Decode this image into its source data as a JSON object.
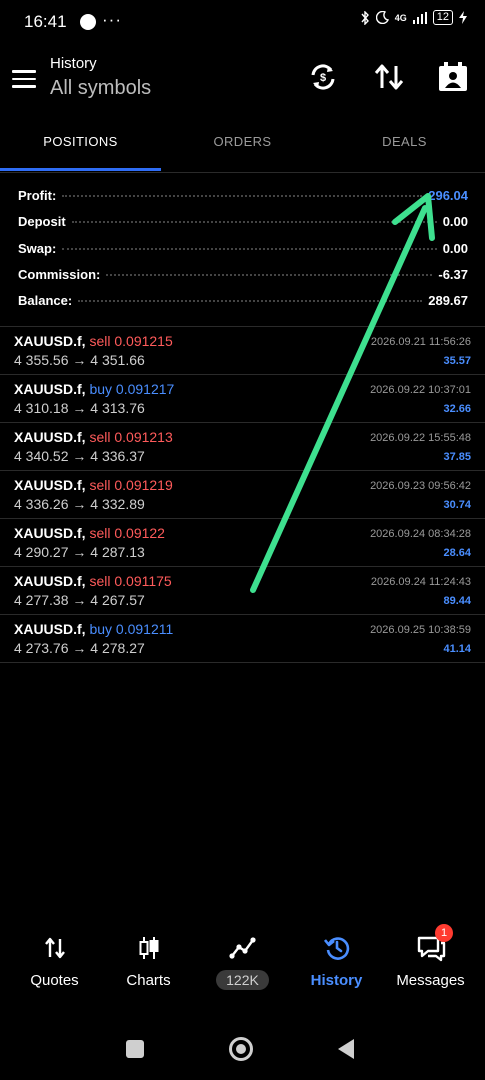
{
  "status_bar": {
    "time": "16:41",
    "dots": "···",
    "network": "4G",
    "battery": "12"
  },
  "header": {
    "title": "History",
    "subtitle": "All symbols"
  },
  "tabs": [
    {
      "label": "POSITIONS",
      "active": true
    },
    {
      "label": "ORDERS",
      "active": false
    },
    {
      "label": "DEALS",
      "active": false
    }
  ],
  "summary": [
    {
      "label": "Profit:",
      "value": "296.04",
      "highlight": true
    },
    {
      "label": "Deposit",
      "value": "0.00",
      "highlight": false
    },
    {
      "label": "Swap:",
      "value": "0.00",
      "highlight": false
    },
    {
      "label": "Commission:",
      "value": "-6.37",
      "highlight": false
    },
    {
      "label": "Balance:",
      "value": "289.67",
      "highlight": false
    }
  ],
  "deals": [
    {
      "symbol": "XAUUSD.f,",
      "side": "sell",
      "volume": "0.091215",
      "open": "4 355.56",
      "arrow": "→",
      "close": "4 351.66",
      "time": "2026.09.21 11:56:26",
      "profit": "35.57"
    },
    {
      "symbol": "XAUUSD.f,",
      "side": "buy",
      "volume": "0.091217",
      "open": "4 310.18",
      "arrow": "→",
      "close": "4 313.76",
      "time": "2026.09.22 10:37:01",
      "profit": "32.66"
    },
    {
      "symbol": "XAUUSD.f,",
      "side": "sell",
      "volume": "0.091213",
      "open": "4 340.52",
      "arrow": "→",
      "close": "4 336.37",
      "time": "2026.09.22 15:55:48",
      "profit": "37.85"
    },
    {
      "symbol": "XAUUSD.f,",
      "side": "sell",
      "volume": "0.091219",
      "open": "4 336.26",
      "arrow": "→",
      "close": "4 332.89",
      "time": "2026.09.23 09:56:42",
      "profit": "30.74"
    },
    {
      "symbol": "XAUUSD.f,",
      "side": "sell",
      "volume": "0.09122",
      "open": "4 290.27",
      "arrow": "→",
      "close": "4 287.13",
      "time": "2026.09.24 08:34:28",
      "profit": "28.64"
    },
    {
      "symbol": "XAUUSD.f,",
      "side": "sell",
      "volume": "0.091175",
      "open": "4 277.38",
      "arrow": "→",
      "close": "4 267.57",
      "time": "2026.09.24 11:24:43",
      "profit": "89.44"
    },
    {
      "symbol": "XAUUSD.f,",
      "side": "buy",
      "volume": "0.091211",
      "open": "4 273.76",
      "arrow": "→",
      "close": "4 278.27",
      "time": "2026.09.25 10:38:59",
      "profit": "41.14"
    }
  ],
  "nav": [
    {
      "label": "Quotes",
      "icon": "quotes-icon"
    },
    {
      "label": "Charts",
      "icon": "charts-icon"
    },
    {
      "label": "122K",
      "icon": "trade-icon"
    },
    {
      "label": "History",
      "icon": "history-icon",
      "active": true
    },
    {
      "label": "Messages",
      "icon": "messages-icon",
      "badge": "1"
    }
  ],
  "colors": {
    "accent": "#4a8eff",
    "sell": "#ff5b5b",
    "annotation": "#3ee08f"
  }
}
